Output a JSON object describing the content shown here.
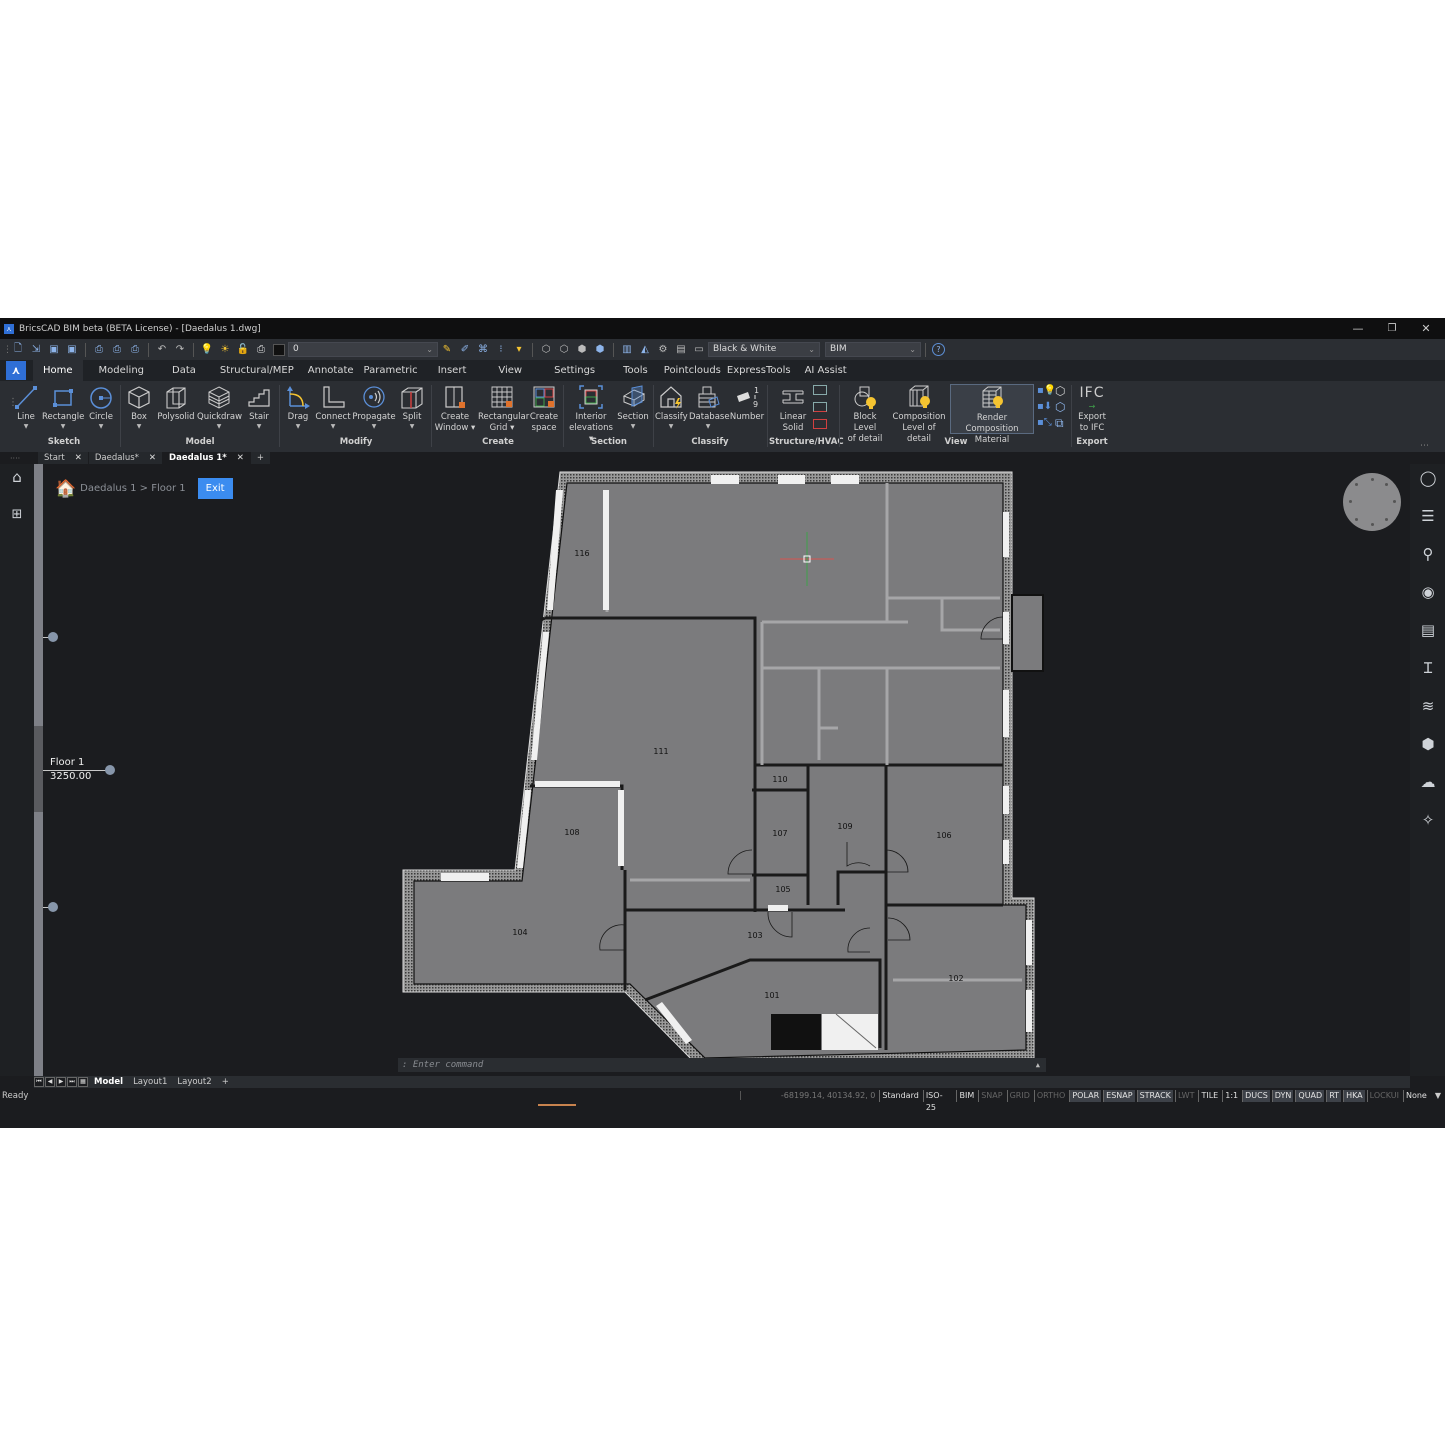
{
  "window": {
    "title": "BricsCAD BIM beta (BETA License) - [Daedalus 1.dwg]",
    "minimize": "—",
    "restore": "❐",
    "close": "✕"
  },
  "quick_access": {
    "layer_value": "0",
    "visual_style": "Black & White",
    "workspace": "BIM"
  },
  "ribbon_tabs": [
    "Home",
    "Modeling",
    "Data",
    "Structural/MEP",
    "Annotate",
    "Parametric",
    "Insert",
    "View",
    "Settings",
    "Tools",
    "Pointclouds",
    "ExpressTools",
    "AI Assist"
  ],
  "ribbon": {
    "tools": {
      "line": "Line",
      "rectangle": "Rectangle",
      "circle": "Circle",
      "box": "Box",
      "polysolid": "Polysolid",
      "quickdraw": "Quickdraw",
      "stair": "Stair",
      "drag": "Drag",
      "connect": "Connect",
      "propagate": "Propagate",
      "split": "Split",
      "create_window_1": "Create",
      "create_window_2": "Window ▾",
      "rect_grid_1": "Rectangular",
      "rect_grid_2": "Grid ▾",
      "create_space_1": "Create",
      "create_space_2": "space",
      "interior_elev_1": "Interior",
      "interior_elev_2": "elevations ▾",
      "section": "Section",
      "classify": "Classify",
      "database": "Database",
      "number": "Number",
      "linear_solid_1": "Linear",
      "linear_solid_2": "Solid",
      "block_lod_1": "Block Level",
      "block_lod_2": "of detail",
      "comp_lod_1": "Composition",
      "comp_lod_2": "Level of detail",
      "render_comp_1": "Render Composition",
      "render_comp_2": "Material",
      "ifc_badge": "IFC",
      "export_ifc_1": "Export",
      "export_ifc_2": "to IFC"
    },
    "groups": {
      "sketch": "Sketch",
      "model": "Model",
      "modify": "Modify",
      "create": "Create",
      "section": "Section",
      "classify": "Classify",
      "structure": "Structure/HVAC",
      "view": "View",
      "export": "Export"
    }
  },
  "doc_tabs": [
    {
      "label": "Start",
      "close": "✕"
    },
    {
      "label": "Daedalus*",
      "close": "✕"
    },
    {
      "label": "Daedalus 1*",
      "close": "✕"
    }
  ],
  "doc_tabs_add": "+",
  "breadcrumb": {
    "path": "Daedalus 1 > Floor 1",
    "exit": "Exit"
  },
  "level": {
    "name": "Floor 1",
    "elevation": "3250.00"
  },
  "rooms": [
    "116",
    "111",
    "110",
    "108",
    "107",
    "109",
    "106",
    "105",
    "104",
    "103",
    "102",
    "101"
  ],
  "command_line": {
    "prompt": ": Enter command"
  },
  "layout_tabs": {
    "model": "Model",
    "layout1": "Layout1",
    "layout2": "Layout2",
    "add": "+"
  },
  "status_bar": {
    "ready": "Ready",
    "coordinates": "-68199.14, 40134.92, 0",
    "toggles": [
      {
        "label": "Standard",
        "state": "on"
      },
      {
        "label": "ISO-25",
        "state": "on"
      },
      {
        "label": "BIM",
        "state": "on"
      },
      {
        "label": "SNAP",
        "state": "off"
      },
      {
        "label": "GRID",
        "state": "off"
      },
      {
        "label": "ORTHO",
        "state": "off"
      },
      {
        "label": "POLAR",
        "state": "hl"
      },
      {
        "label": "ESNAP",
        "state": "hl"
      },
      {
        "label": "STRACK",
        "state": "hl"
      },
      {
        "label": "LWT",
        "state": "off"
      },
      {
        "label": "TILE",
        "state": "on"
      },
      {
        "label": "1:1",
        "state": "on"
      },
      {
        "label": "DUCS",
        "state": "hl"
      },
      {
        "label": "DYN",
        "state": "hl"
      },
      {
        "label": "QUAD",
        "state": "hl"
      },
      {
        "label": "RT",
        "state": "hl"
      },
      {
        "label": "HKA",
        "state": "hl"
      },
      {
        "label": "LOCKUI",
        "state": "off"
      },
      {
        "label": "None",
        "state": "on"
      }
    ]
  },
  "colors": {
    "accent": "#3b8cf0",
    "app_bg": "#1b1c1f",
    "ribbon_bg": "#2b2e33",
    "room_fill": "#7b7b7d",
    "highlight_bulb": "#f5c431"
  }
}
